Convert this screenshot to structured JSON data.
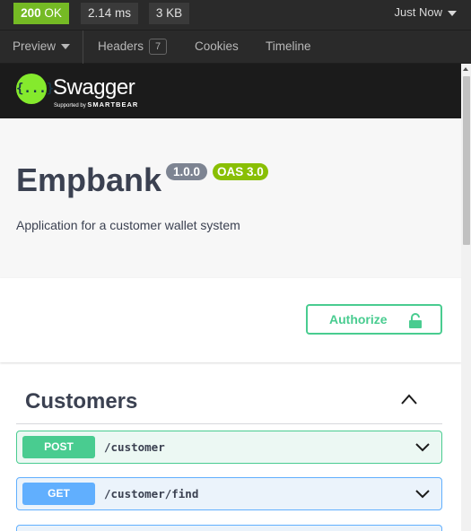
{
  "status": {
    "code": "200",
    "text": "OK",
    "time": "2.14 ms",
    "size": "3 KB",
    "timestamp": "Just Now"
  },
  "tabs": {
    "preview": "Preview",
    "headers": "Headers",
    "headers_count": "7",
    "cookies": "Cookies",
    "timeline": "Timeline"
  },
  "swagger": {
    "logo_glyph": "{...}",
    "brand": "Swagger",
    "supported_by": "Supported by",
    "smartbear": "SMARTBEAR"
  },
  "api": {
    "title": "Empbank",
    "version": "1.0.0",
    "oas": "OAS 3.0",
    "description": "Application for a customer wallet system"
  },
  "auth": {
    "label": "Authorize"
  },
  "section": {
    "title": "Customers",
    "operations": [
      {
        "method": "POST",
        "path": "/customer"
      },
      {
        "method": "GET",
        "path": "/customer/find"
      }
    ]
  },
  "colors": {
    "ok_green": "#75ba24",
    "post_green": "#49cc90",
    "get_blue": "#61affe",
    "version_gray": "#7d8492",
    "oas_green": "#89bf04"
  }
}
